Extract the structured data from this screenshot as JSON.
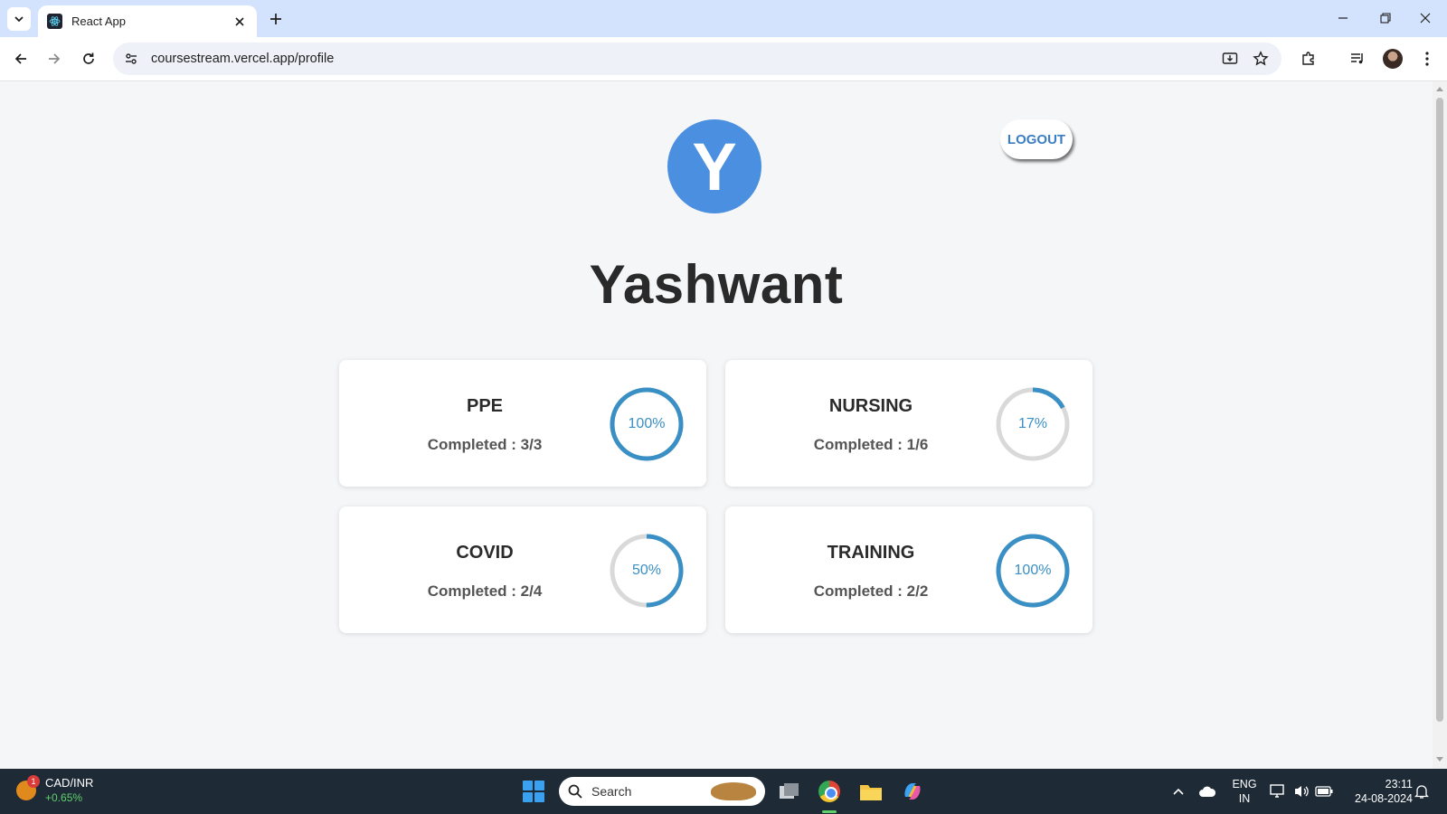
{
  "browser": {
    "tab_title": "React App",
    "url": "coursestream.vercel.app/profile"
  },
  "profile": {
    "avatar_initial": "Y",
    "name": "Yashwant",
    "logout_label": "LOGOUT",
    "accent_color": "#4a8fe0",
    "ring_color": "#3a8fc4",
    "ring_track_color": "#d9d9d9"
  },
  "courses": [
    {
      "title": "PPE",
      "completed_text": "Completed : 3/3",
      "percent_label": "100%",
      "progress": 1.0
    },
    {
      "title": "NURSING",
      "completed_text": "Completed : 1/6",
      "percent_label": "17%",
      "progress": 0.17
    },
    {
      "title": "COVID",
      "completed_text": "Completed : 2/4",
      "percent_label": "50%",
      "progress": 0.5
    },
    {
      "title": "TRAINING",
      "completed_text": "Completed : 2/2",
      "percent_label": "100%",
      "progress": 1.0
    }
  ],
  "taskbar": {
    "widget_badge": "1",
    "widget_pair": "CAD/INR",
    "widget_change": "+0.65%",
    "search_label": "Search",
    "lang_line1": "ENG",
    "lang_line2": "IN",
    "time": "23:11",
    "date": "24-08-2024"
  }
}
